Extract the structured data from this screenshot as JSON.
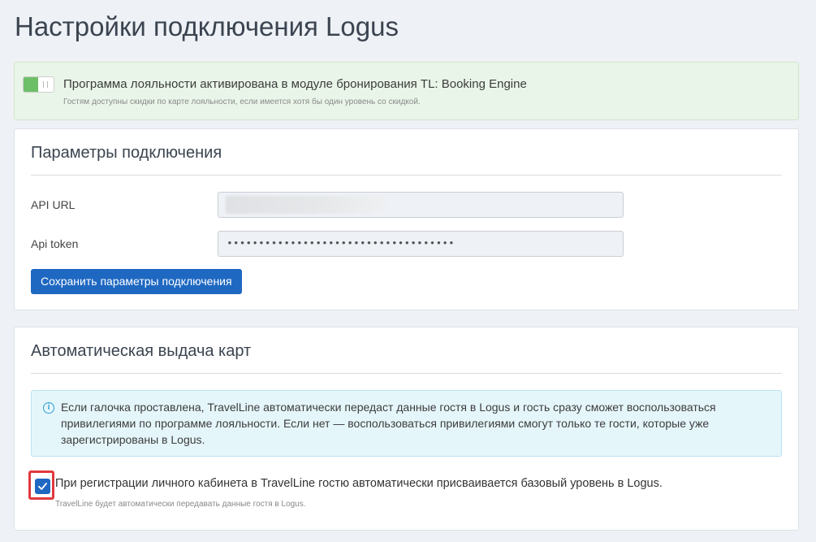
{
  "page": {
    "title": "Настройки подключения Logus"
  },
  "loyalty_banner": {
    "title": "Программа лояльности активирована в модуле бронирования TL: Booking Engine",
    "subtitle": "Гостям доступны скидки по карте лояльности, если имеется хотя бы один уровень со скидкой.",
    "toggle_on": true,
    "toggle_color": "#6dbf67"
  },
  "connection": {
    "title": "Параметры подключения",
    "api_url_label": "API URL",
    "api_token_label": "Api token",
    "api_token_value": "••••••••••••••••••••••••••••••••••••",
    "save_button": "Сохранить параметры подключения"
  },
  "auto_cards": {
    "title": "Автоматическая выдача карт",
    "info_icon": "info-circle-icon",
    "info_text": "Если галочка проставлена, TravelLine автоматически передаст данные гостя в Logus и гость сразу сможет воспользоваться привилегиями по программе лояльности. Если нет — воспользоваться привилегиями смогут только те гости, которые уже зарегистрированы в Logus.",
    "checkbox_checked": true,
    "checkbox_label": "При регистрации личного кабинета в TravelLine гостю автоматически присваивается базовый уровень в Logus.",
    "checkbox_sub": "TravelLine будет автоматически передавать данные гостя в Logus."
  },
  "colors": {
    "accent": "#1f68c2",
    "highlight": "#e0393e",
    "info_bg": "#e5f6fb",
    "success_bg": "#e9f5e8"
  }
}
